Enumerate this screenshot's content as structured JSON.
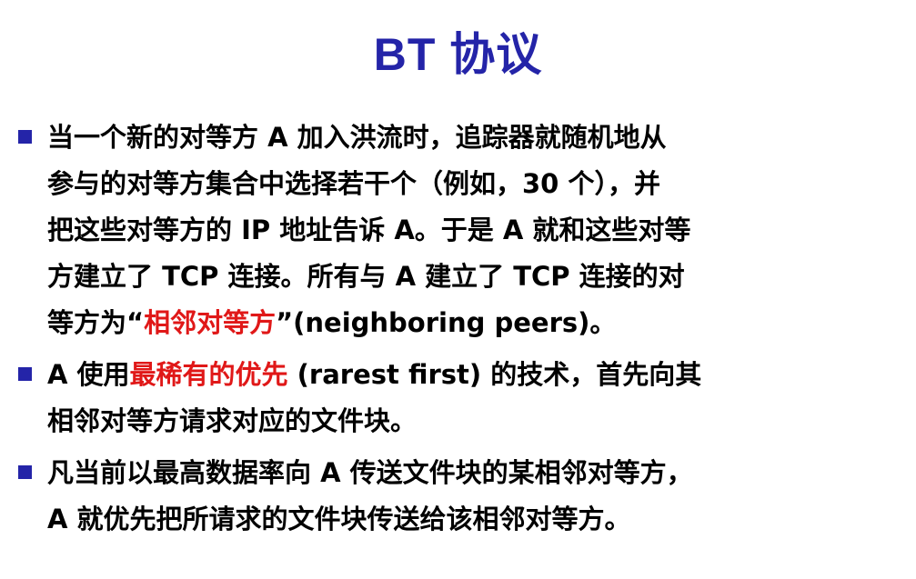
{
  "slide": {
    "title": "BT 协议",
    "bullets": [
      {
        "lines": [
          {
            "parts": [
              {
                "text": "当一个新的对等方 A 加入洪流时，追踪器就随机地从"
              }
            ]
          },
          {
            "parts": [
              {
                "text": "参与的对等方集合中选择若干个（例如，30 个），并"
              }
            ]
          },
          {
            "parts": [
              {
                "text": "把这些对等方的 IP 地址告诉 A。于是 A 就和这些对等"
              }
            ]
          },
          {
            "parts": [
              {
                "text": "方建立了 TCP 连接。所有与 A 建立了 TCP 连接的对"
              }
            ]
          },
          {
            "parts": [
              {
                "text": "等方为“"
              },
              {
                "text": "相邻对等方",
                "highlight": true
              },
              {
                "text": "”(neighboring peers)。"
              }
            ]
          }
        ]
      },
      {
        "lines": [
          {
            "parts": [
              {
                "text": "A 使用"
              },
              {
                "text": "最稀有的优先",
                "highlight": true
              },
              {
                "text": " (rarest first) 的技术，首先向其"
              }
            ]
          },
          {
            "parts": [
              {
                "text": "相邻对等方请求对应的文件块。"
              }
            ]
          }
        ]
      },
      {
        "lines": [
          {
            "parts": [
              {
                "text": "凡当前以最高数据率向 A 传送文件块的某相邻对等方，"
              }
            ]
          },
          {
            "parts": [
              {
                "text": "A 就优先把所请求的文件块传送给该相邻对等方。"
              }
            ]
          }
        ]
      }
    ]
  },
  "colors": {
    "title": "#2424a8",
    "bullet_marker": "#2424a8",
    "highlight": "#e01818",
    "text": "#000000",
    "background": "#ffffff"
  },
  "icons": {
    "bullet_marker": "square-bullet-icon"
  }
}
